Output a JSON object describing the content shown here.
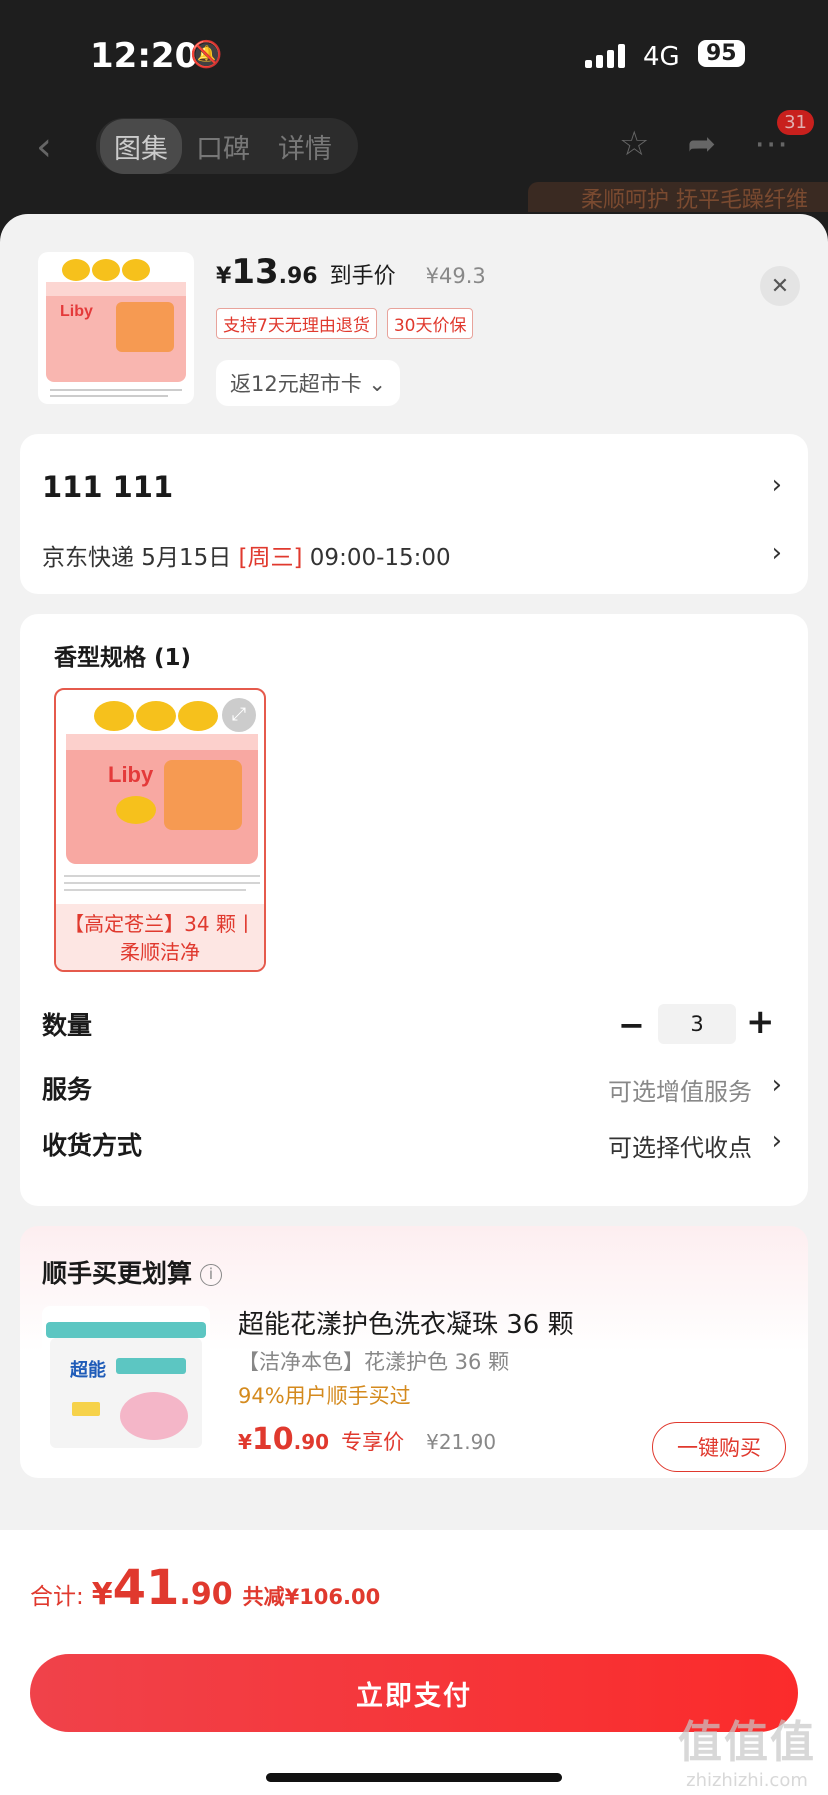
{
  "status": {
    "time": "12:20",
    "network": "4G",
    "battery": "95"
  },
  "nav": {
    "tabs": [
      "图集",
      "口碑",
      "详情"
    ],
    "badge": "31",
    "promo_peek": "柔顺呵护 抚平毛躁纤维"
  },
  "product": {
    "currency": "¥",
    "price_int": "13",
    "price_dec": ".96",
    "price_tag": "到手价",
    "orig_price": "¥49.3",
    "tags": [
      "支持7天无理由退货",
      "30天价保"
    ],
    "card_chip": "返12元超市卡",
    "brand": "Liby"
  },
  "address": {
    "name": "111  111",
    "courier": "京东快递 5月15日",
    "weekday": "[周三]",
    "time_window": "09:00-15:00"
  },
  "spec": {
    "title": "香型规格 (1)",
    "item_label_line1": "【高定苍兰】34 颗丨",
    "item_label_line2": "柔顺洁净"
  },
  "rows": {
    "quantity_label": "数量",
    "quantity_value": "3",
    "service_label": "服务",
    "service_value": "可选增值服务",
    "delivery_label": "收货方式",
    "delivery_value": "可选择代收点"
  },
  "upsell": {
    "title": "顺手买更划算",
    "name": "超能花漾护色洗衣凝珠 36 颗",
    "variant": "【洁净本色】花漾护色 36 颗",
    "social": "94%用户顺手买过",
    "currency": "¥",
    "price_int": "10",
    "price_dec": ".90",
    "price_tag": "专享价",
    "orig_price": "¥21.90",
    "buy_label": "一键购买",
    "brand": "超能"
  },
  "footer": {
    "total_label": "合计:",
    "currency": "¥",
    "total_int": "41",
    "total_dec": ".90",
    "savings": "共减¥106.00",
    "pay_label": "立即支付"
  },
  "watermark": {
    "big": "值值值",
    "small": "zhizhizhi.com"
  },
  "colors": {
    "accent": "#e0392e",
    "pay_button": "#f0424a",
    "social_proof": "#d48a1e"
  }
}
